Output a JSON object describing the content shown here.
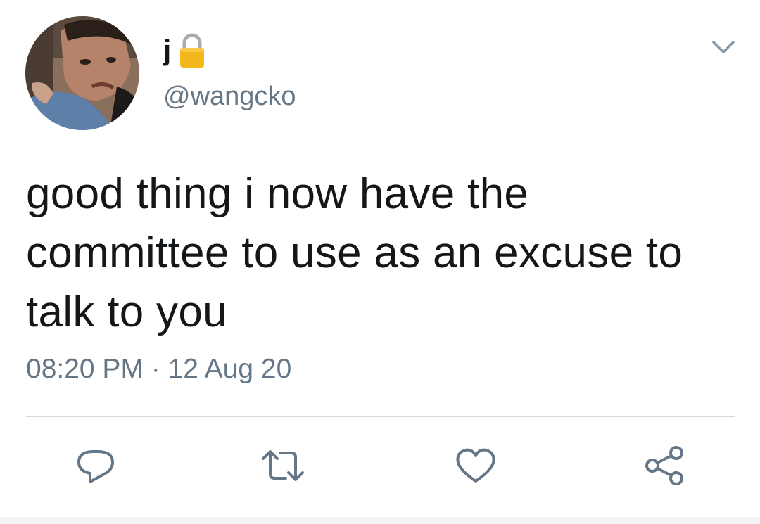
{
  "user": {
    "display_name": "j",
    "handle": "@wangcko",
    "avatar": "profile-photo",
    "protected_icon": "lock-icon"
  },
  "tweet": {
    "text": "good thing i now have the committee to use as an excuse to talk to you",
    "timestamp": "08:20 PM · 12 Aug 20"
  },
  "actions": {
    "reply_icon": "reply-icon",
    "retweet_icon": "retweet-icon",
    "like_icon": "heart-icon",
    "share_icon": "share-icon"
  },
  "menu_icon": "chevron-down-icon",
  "colors": {
    "text": "#14171a",
    "secondary": "#657786",
    "divider": "#cfd9de",
    "lock": "#f5b81c"
  }
}
